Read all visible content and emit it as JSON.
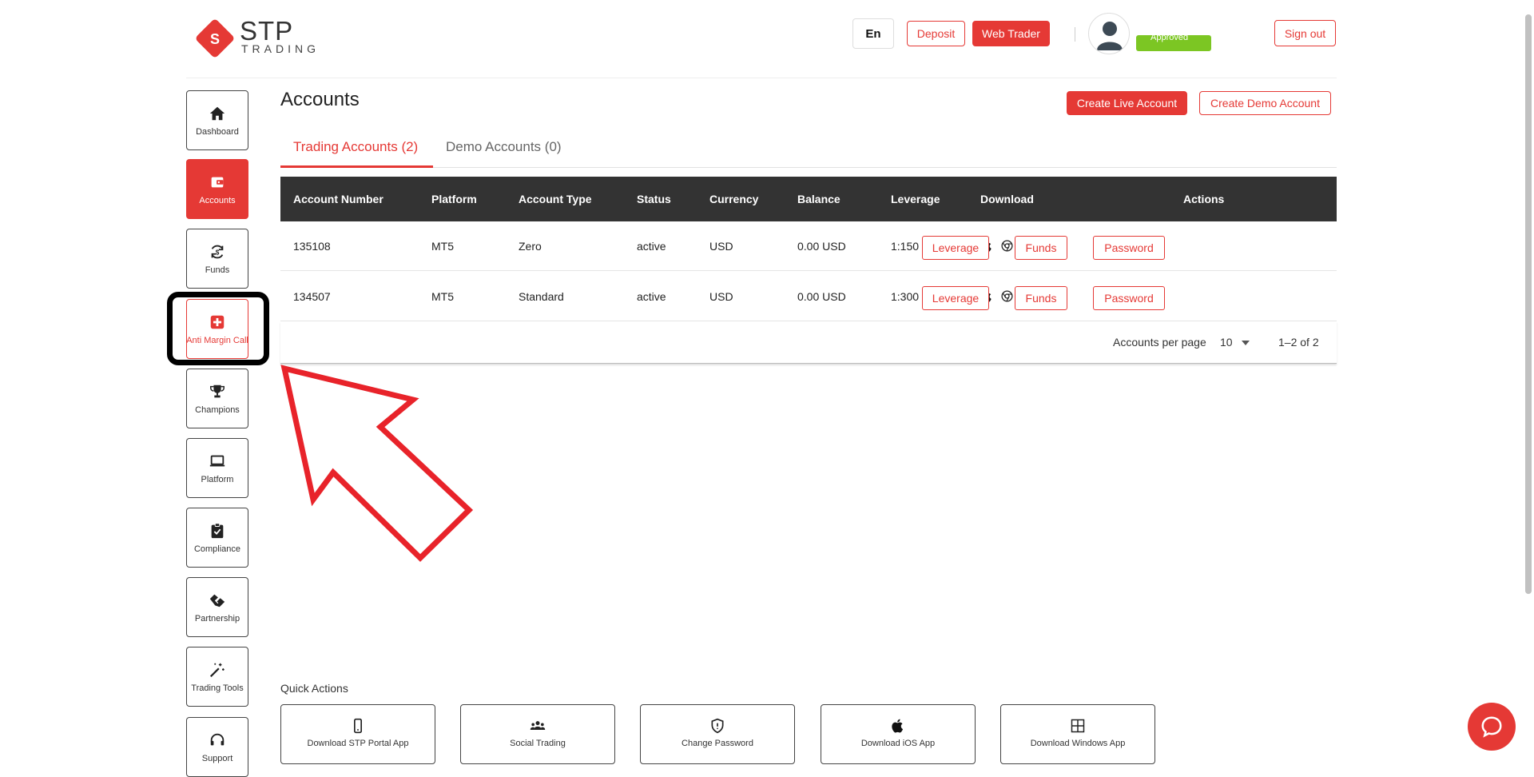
{
  "header": {
    "logo_text": "STP",
    "logo_subtext": "TRADING",
    "lang_label": "En",
    "deposit_label": "Deposit",
    "web_trader_label": "Web Trader",
    "approved_label": "Approved",
    "sign_out_label": "Sign out"
  },
  "sidebar": {
    "items": [
      {
        "label": "Dashboard",
        "icon": "home-icon"
      },
      {
        "label": "Accounts",
        "icon": "wallet-icon"
      },
      {
        "label": "Funds",
        "icon": "funds-icon"
      },
      {
        "label": "Anti Margin Call",
        "icon": "medical-cross-icon"
      },
      {
        "label": "Champions",
        "icon": "trophy-icon"
      },
      {
        "label": "Platform",
        "icon": "laptop-icon"
      },
      {
        "label": "Compliance",
        "icon": "clipboard-check-icon"
      },
      {
        "label": "Partnership",
        "icon": "handshake-icon"
      },
      {
        "label": "Trading Tools",
        "icon": "magic-wand-icon"
      },
      {
        "label": "Support",
        "icon": "headset-icon"
      }
    ]
  },
  "main": {
    "title": "Accounts",
    "create_live_label": "Create Live Account",
    "create_demo_label": "Create Demo Account",
    "tabs": [
      {
        "label": "Trading Accounts (2)"
      },
      {
        "label": "Demo Accounts (0)"
      }
    ],
    "table": {
      "headers": [
        "Account Number",
        "Platform",
        "Account Type",
        "Status",
        "Currency",
        "Balance",
        "Leverage",
        "Download",
        "Actions"
      ],
      "rows": [
        {
          "account": "135108",
          "platform": "MT5",
          "type": "Zero",
          "status": "active",
          "currency": "USD",
          "balance": "0.00 USD",
          "leverage": "1:150"
        },
        {
          "account": "134507",
          "platform": "MT5",
          "type": "Standard",
          "status": "active",
          "currency": "USD",
          "balance": "0.00 USD",
          "leverage": "1:300"
        }
      ],
      "action_labels": {
        "leverage": "Leverage",
        "funds": "Funds",
        "password": "Password"
      }
    },
    "pagination": {
      "per_page_label": "Accounts per page",
      "per_page_value": "10",
      "range": "1–2 of 2"
    }
  },
  "quick_actions": {
    "title": "Quick Actions",
    "items": [
      {
        "label": "Download STP Portal App",
        "icon": "phone-icon"
      },
      {
        "label": "Social Trading",
        "icon": "group-icon"
      },
      {
        "label": "Change Password",
        "icon": "shield-icon"
      },
      {
        "label": "Download iOS App",
        "icon": "apple-icon"
      },
      {
        "label": "Download Windows App",
        "icon": "windows-icon"
      }
    ]
  },
  "colors": {
    "accent": "#e53935",
    "header_dark": "#333333",
    "approved": "#7cc623"
  }
}
